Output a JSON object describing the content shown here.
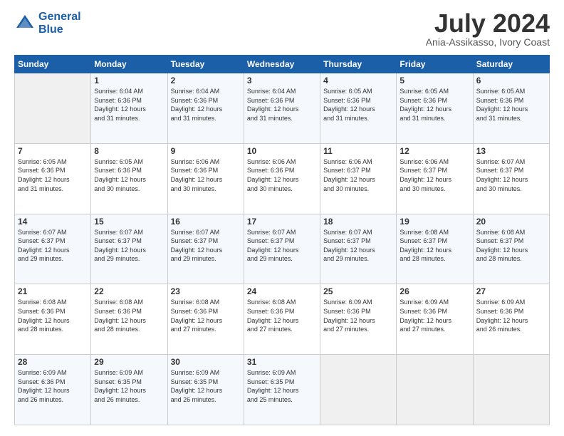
{
  "header": {
    "logo_line1": "General",
    "logo_line2": "Blue",
    "month": "July 2024",
    "location": "Ania-Assikasso, Ivory Coast"
  },
  "weekdays": [
    "Sunday",
    "Monday",
    "Tuesday",
    "Wednesday",
    "Thursday",
    "Friday",
    "Saturday"
  ],
  "weeks": [
    [
      {
        "day": "",
        "info": ""
      },
      {
        "day": "1",
        "info": "Sunrise: 6:04 AM\nSunset: 6:36 PM\nDaylight: 12 hours\nand 31 minutes."
      },
      {
        "day": "2",
        "info": "Sunrise: 6:04 AM\nSunset: 6:36 PM\nDaylight: 12 hours\nand 31 minutes."
      },
      {
        "day": "3",
        "info": "Sunrise: 6:04 AM\nSunset: 6:36 PM\nDaylight: 12 hours\nand 31 minutes."
      },
      {
        "day": "4",
        "info": "Sunrise: 6:05 AM\nSunset: 6:36 PM\nDaylight: 12 hours\nand 31 minutes."
      },
      {
        "day": "5",
        "info": "Sunrise: 6:05 AM\nSunset: 6:36 PM\nDaylight: 12 hours\nand 31 minutes."
      },
      {
        "day": "6",
        "info": "Sunrise: 6:05 AM\nSunset: 6:36 PM\nDaylight: 12 hours\nand 31 minutes."
      }
    ],
    [
      {
        "day": "7",
        "info": "Sunrise: 6:05 AM\nSunset: 6:36 PM\nDaylight: 12 hours\nand 31 minutes."
      },
      {
        "day": "8",
        "info": "Sunrise: 6:05 AM\nSunset: 6:36 PM\nDaylight: 12 hours\nand 30 minutes."
      },
      {
        "day": "9",
        "info": "Sunrise: 6:06 AM\nSunset: 6:36 PM\nDaylight: 12 hours\nand 30 minutes."
      },
      {
        "day": "10",
        "info": "Sunrise: 6:06 AM\nSunset: 6:36 PM\nDaylight: 12 hours\nand 30 minutes."
      },
      {
        "day": "11",
        "info": "Sunrise: 6:06 AM\nSunset: 6:37 PM\nDaylight: 12 hours\nand 30 minutes."
      },
      {
        "day": "12",
        "info": "Sunrise: 6:06 AM\nSunset: 6:37 PM\nDaylight: 12 hours\nand 30 minutes."
      },
      {
        "day": "13",
        "info": "Sunrise: 6:07 AM\nSunset: 6:37 PM\nDaylight: 12 hours\nand 30 minutes."
      }
    ],
    [
      {
        "day": "14",
        "info": "Sunrise: 6:07 AM\nSunset: 6:37 PM\nDaylight: 12 hours\nand 29 minutes."
      },
      {
        "day": "15",
        "info": "Sunrise: 6:07 AM\nSunset: 6:37 PM\nDaylight: 12 hours\nand 29 minutes."
      },
      {
        "day": "16",
        "info": "Sunrise: 6:07 AM\nSunset: 6:37 PM\nDaylight: 12 hours\nand 29 minutes."
      },
      {
        "day": "17",
        "info": "Sunrise: 6:07 AM\nSunset: 6:37 PM\nDaylight: 12 hours\nand 29 minutes."
      },
      {
        "day": "18",
        "info": "Sunrise: 6:07 AM\nSunset: 6:37 PM\nDaylight: 12 hours\nand 29 minutes."
      },
      {
        "day": "19",
        "info": "Sunrise: 6:08 AM\nSunset: 6:37 PM\nDaylight: 12 hours\nand 28 minutes."
      },
      {
        "day": "20",
        "info": "Sunrise: 6:08 AM\nSunset: 6:37 PM\nDaylight: 12 hours\nand 28 minutes."
      }
    ],
    [
      {
        "day": "21",
        "info": "Sunrise: 6:08 AM\nSunset: 6:36 PM\nDaylight: 12 hours\nand 28 minutes."
      },
      {
        "day": "22",
        "info": "Sunrise: 6:08 AM\nSunset: 6:36 PM\nDaylight: 12 hours\nand 28 minutes."
      },
      {
        "day": "23",
        "info": "Sunrise: 6:08 AM\nSunset: 6:36 PM\nDaylight: 12 hours\nand 27 minutes."
      },
      {
        "day": "24",
        "info": "Sunrise: 6:08 AM\nSunset: 6:36 PM\nDaylight: 12 hours\nand 27 minutes."
      },
      {
        "day": "25",
        "info": "Sunrise: 6:09 AM\nSunset: 6:36 PM\nDaylight: 12 hours\nand 27 minutes."
      },
      {
        "day": "26",
        "info": "Sunrise: 6:09 AM\nSunset: 6:36 PM\nDaylight: 12 hours\nand 27 minutes."
      },
      {
        "day": "27",
        "info": "Sunrise: 6:09 AM\nSunset: 6:36 PM\nDaylight: 12 hours\nand 26 minutes."
      }
    ],
    [
      {
        "day": "28",
        "info": "Sunrise: 6:09 AM\nSunset: 6:36 PM\nDaylight: 12 hours\nand 26 minutes."
      },
      {
        "day": "29",
        "info": "Sunrise: 6:09 AM\nSunset: 6:35 PM\nDaylight: 12 hours\nand 26 minutes."
      },
      {
        "day": "30",
        "info": "Sunrise: 6:09 AM\nSunset: 6:35 PM\nDaylight: 12 hours\nand 26 minutes."
      },
      {
        "day": "31",
        "info": "Sunrise: 6:09 AM\nSunset: 6:35 PM\nDaylight: 12 hours\nand 25 minutes."
      },
      {
        "day": "",
        "info": ""
      },
      {
        "day": "",
        "info": ""
      },
      {
        "day": "",
        "info": ""
      }
    ]
  ]
}
